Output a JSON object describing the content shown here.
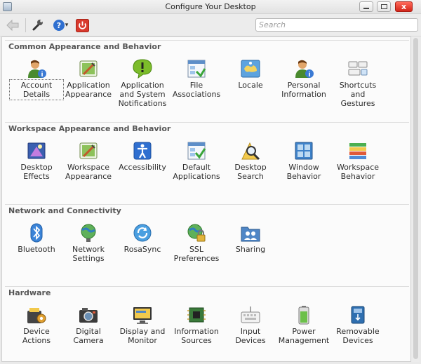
{
  "window": {
    "title": "Configure Your Desktop",
    "close_glyph": "x"
  },
  "toolbar": {
    "back_icon": "back-arrow-icon",
    "settings_icon": "wrench-icon",
    "help_icon": "help-icon",
    "help_dropdown": "▾",
    "quit_icon": "power-icon",
    "search_placeholder": "Search"
  },
  "colors": {
    "section_title": "#555555",
    "background": "#fbfbfb",
    "close_button": "#d93a2e",
    "help_blue": "#2f6fd0"
  },
  "sections": [
    {
      "title": "Common Appearance and Behavior",
      "items": [
        {
          "label": "Account\nDetails",
          "icon": "account-icon",
          "focused": true
        },
        {
          "label": "Application\nAppearance",
          "icon": "appearance-icon"
        },
        {
          "label": "Application\nand System\nNotifications",
          "icon": "notification-icon"
        },
        {
          "label": "File\nAssociations",
          "icon": "file-associations-icon"
        },
        {
          "label": "Locale",
          "icon": "locale-icon"
        },
        {
          "label": "Personal\nInformation",
          "icon": "person-icon"
        },
        {
          "label": "Shortcuts\nand\nGestures",
          "icon": "shortcuts-icon"
        }
      ]
    },
    {
      "title": "Workspace Appearance and Behavior",
      "items": [
        {
          "label": "Desktop\nEffects",
          "icon": "desktop-effects-icon"
        },
        {
          "label": "Workspace\nAppearance",
          "icon": "workspace-appearance-icon"
        },
        {
          "label": "Accessibility",
          "icon": "accessibility-icon"
        },
        {
          "label": "Default\nApplications",
          "icon": "default-applications-icon"
        },
        {
          "label": "Desktop\nSearch",
          "icon": "desktop-search-icon"
        },
        {
          "label": "Window\nBehavior",
          "icon": "window-behavior-icon"
        },
        {
          "label": "Workspace\nBehavior",
          "icon": "workspace-behavior-icon"
        }
      ]
    },
    {
      "title": "Network and Connectivity",
      "items": [
        {
          "label": "Bluetooth",
          "icon": "bluetooth-icon"
        },
        {
          "label": "Network\nSettings",
          "icon": "network-globe-icon"
        },
        {
          "label": "RosaSync",
          "icon": "sync-icon"
        },
        {
          "label": "SSL\nPreferences",
          "icon": "ssl-lock-icon"
        },
        {
          "label": "Sharing",
          "icon": "sharing-folder-icon"
        }
      ]
    },
    {
      "title": "Hardware",
      "items": [
        {
          "label": "Device\nActions",
          "icon": "device-actions-icon"
        },
        {
          "label": "Digital\nCamera",
          "icon": "camera-icon"
        },
        {
          "label": "Display and\nMonitor",
          "icon": "display-icon"
        },
        {
          "label": "Information\nSources",
          "icon": "chip-icon"
        },
        {
          "label": "Input\nDevices",
          "icon": "keyboard-icon"
        },
        {
          "label": "Power\nManagement",
          "icon": "battery-icon"
        },
        {
          "label": "Removable\nDevices",
          "icon": "removable-drive-icon"
        }
      ]
    }
  ]
}
